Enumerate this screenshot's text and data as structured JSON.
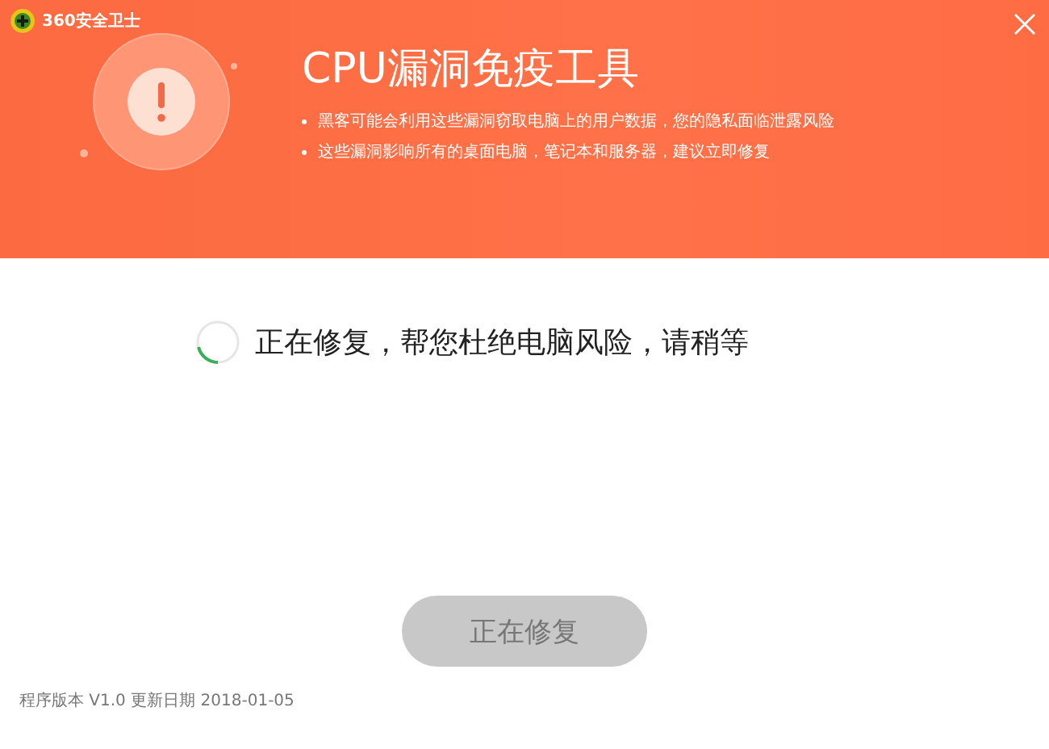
{
  "window": {
    "title": "360安全卫士"
  },
  "header": {
    "title": "CPU漏洞免疫工具",
    "bullets": [
      "黑客可能会利用这些漏洞窃取电脑上的用户数据，您的隐私面临泄露风险",
      "这些漏洞影响所有的桌面电脑，笔记本和服务器，建议立即修复"
    ]
  },
  "status": {
    "text": "正在修复，帮您杜绝电脑风险，请稍等"
  },
  "action_button": {
    "label": "正在修复",
    "disabled": true
  },
  "footer": {
    "version": "程序版本 V1.0 更新日期 2018-01-05"
  }
}
